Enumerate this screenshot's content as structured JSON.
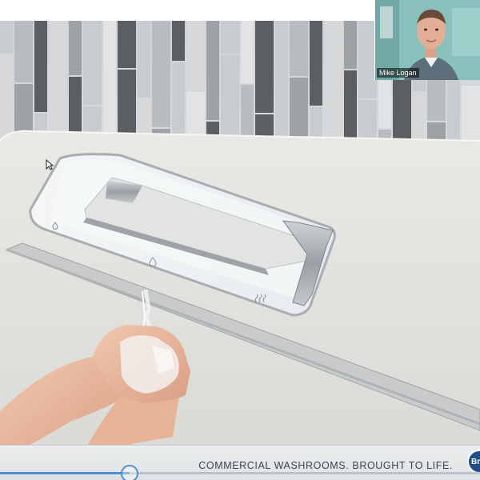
{
  "presentation": {
    "tagline": "COMMERCIAL  WASHROOMS.  BROUGHT TO LIFE.",
    "logo_text": "Bra"
  },
  "participant": {
    "name": "Mike Logan"
  },
  "playback": {
    "progress_fraction": 0.27
  },
  "colors": {
    "accent": "#4f8fd4",
    "logo": "#1f4f86",
    "counter": "#e6e6e3",
    "tile_dark": "#5c5f62",
    "tile_light": "#c9ccce"
  },
  "icons": {
    "cursor": "arrow-cursor-icon",
    "soap": "soap-drop-icon",
    "water": "water-drop-icon",
    "dryer": "air-dryer-icon"
  }
}
